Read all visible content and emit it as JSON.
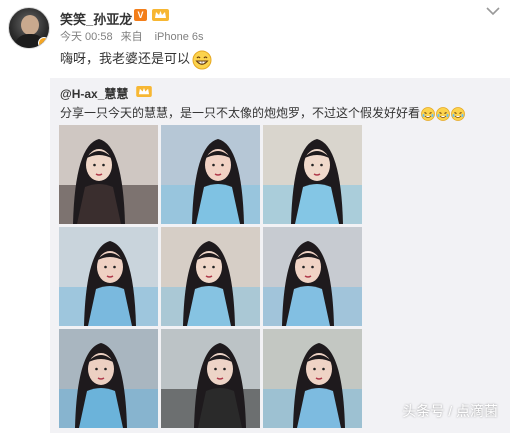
{
  "author": {
    "name": "笑笑_孙亚龙",
    "vip_badge": "V",
    "avatar_icon": "avatar-portrait"
  },
  "meta": {
    "time": "今天 00:58",
    "source_prefix": "来自",
    "source": "iPhone 6s"
  },
  "post_text": "嗨呀，我老婆还是可以",
  "repost": {
    "user": "@H-ax_慧慧",
    "text": "分享一只今天的慧慧，是一只不太像的炮炮罗，不过这个假发好好看",
    "photos": [
      {
        "name": "photo-1",
        "bg": "#cfc7c2",
        "skin": "#f0d7c8",
        "accent": "#3a2e2e"
      },
      {
        "name": "photo-2",
        "bg": "#b6c7d6",
        "skin": "#f1d2c4",
        "accent": "#7fc2e3"
      },
      {
        "name": "photo-3",
        "bg": "#d9d5cd",
        "skin": "#f0d9cb",
        "accent": "#84c6e5"
      },
      {
        "name": "photo-4",
        "bg": "#c9d4dc",
        "skin": "#efd1c3",
        "accent": "#7ab9de"
      },
      {
        "name": "photo-5",
        "bg": "#d6cec6",
        "skin": "#efd7c9",
        "accent": "#86c3e2"
      },
      {
        "name": "photo-6",
        "bg": "#c7cbd1",
        "skin": "#f0d3c5",
        "accent": "#82bfe2"
      },
      {
        "name": "photo-7",
        "bg": "#a9b6c0",
        "skin": "#ecd0c2",
        "accent": "#6bb3da"
      },
      {
        "name": "photo-8",
        "bg": "#bcc3c6",
        "skin": "#edd4c7",
        "accent": "#2a2a2a"
      },
      {
        "name": "photo-9",
        "bg": "#c3c7c2",
        "skin": "#efd3c5",
        "accent": "#7dbbe0"
      }
    ]
  },
  "watermark": "头条号 / 点滴菌",
  "colors": {
    "repost_bg": "#f2f2f5",
    "vip_orange": "#f37e1a",
    "meta_gray": "#808080"
  }
}
